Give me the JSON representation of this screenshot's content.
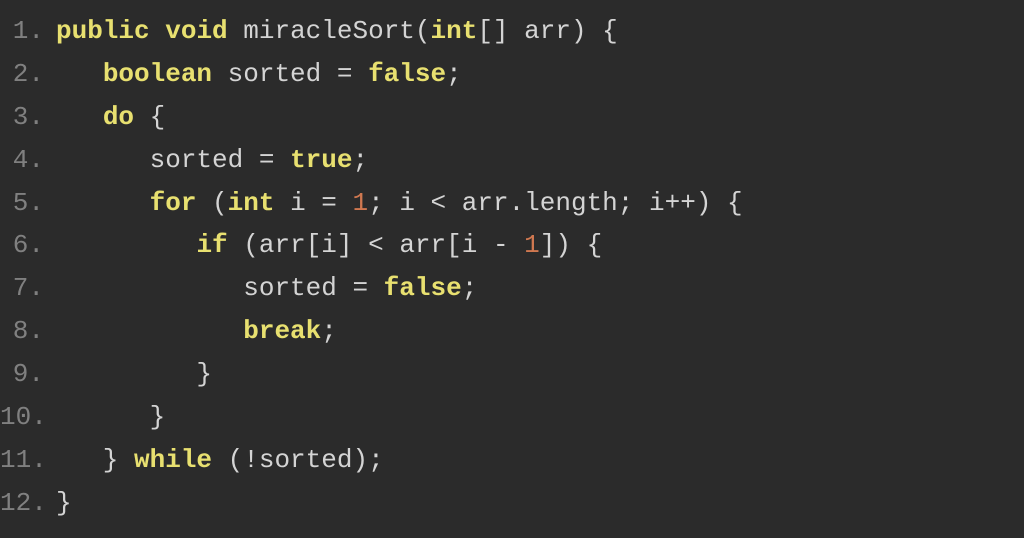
{
  "code": {
    "lines": [
      {
        "num": "1.",
        "tokens": [
          {
            "cls": "keyword",
            "t": "public"
          },
          {
            "cls": "punct",
            "t": " "
          },
          {
            "cls": "keyword",
            "t": "void"
          },
          {
            "cls": "punct",
            "t": " "
          },
          {
            "cls": "ident",
            "t": "miracleSort"
          },
          {
            "cls": "punct",
            "t": "("
          },
          {
            "cls": "type",
            "t": "int"
          },
          {
            "cls": "punct",
            "t": "[] "
          },
          {
            "cls": "ident",
            "t": "arr"
          },
          {
            "cls": "punct",
            "t": ") {"
          }
        ]
      },
      {
        "num": "2.",
        "tokens": [
          {
            "cls": "punct",
            "t": "   "
          },
          {
            "cls": "type",
            "t": "boolean"
          },
          {
            "cls": "punct",
            "t": " "
          },
          {
            "cls": "ident",
            "t": "sorted"
          },
          {
            "cls": "punct",
            "t": " = "
          },
          {
            "cls": "bool",
            "t": "false"
          },
          {
            "cls": "punct",
            "t": ";"
          }
        ]
      },
      {
        "num": "3.",
        "tokens": [
          {
            "cls": "punct",
            "t": "   "
          },
          {
            "cls": "keyword",
            "t": "do"
          },
          {
            "cls": "punct",
            "t": " {"
          }
        ]
      },
      {
        "num": "4.",
        "tokens": [
          {
            "cls": "punct",
            "t": "      "
          },
          {
            "cls": "ident",
            "t": "sorted"
          },
          {
            "cls": "punct",
            "t": " = "
          },
          {
            "cls": "bool",
            "t": "true"
          },
          {
            "cls": "punct",
            "t": ";"
          }
        ]
      },
      {
        "num": "5.",
        "tokens": [
          {
            "cls": "punct",
            "t": "      "
          },
          {
            "cls": "keyword",
            "t": "for"
          },
          {
            "cls": "punct",
            "t": " ("
          },
          {
            "cls": "type",
            "t": "int"
          },
          {
            "cls": "punct",
            "t": " "
          },
          {
            "cls": "ident",
            "t": "i"
          },
          {
            "cls": "punct",
            "t": " = "
          },
          {
            "cls": "num",
            "t": "1"
          },
          {
            "cls": "punct",
            "t": "; "
          },
          {
            "cls": "ident",
            "t": "i"
          },
          {
            "cls": "punct",
            "t": " < "
          },
          {
            "cls": "ident",
            "t": "arr"
          },
          {
            "cls": "punct",
            "t": "."
          },
          {
            "cls": "ident",
            "t": "length"
          },
          {
            "cls": "punct",
            "t": "; "
          },
          {
            "cls": "ident",
            "t": "i"
          },
          {
            "cls": "punct",
            "t": "++) {"
          }
        ]
      },
      {
        "num": "6.",
        "tokens": [
          {
            "cls": "punct",
            "t": "         "
          },
          {
            "cls": "keyword",
            "t": "if"
          },
          {
            "cls": "punct",
            "t": " ("
          },
          {
            "cls": "ident",
            "t": "arr"
          },
          {
            "cls": "punct",
            "t": "["
          },
          {
            "cls": "ident",
            "t": "i"
          },
          {
            "cls": "punct",
            "t": "] < "
          },
          {
            "cls": "ident",
            "t": "arr"
          },
          {
            "cls": "punct",
            "t": "["
          },
          {
            "cls": "ident",
            "t": "i"
          },
          {
            "cls": "punct",
            "t": " - "
          },
          {
            "cls": "num",
            "t": "1"
          },
          {
            "cls": "punct",
            "t": "]) {"
          }
        ]
      },
      {
        "num": "7.",
        "tokens": [
          {
            "cls": "punct",
            "t": "            "
          },
          {
            "cls": "ident",
            "t": "sorted"
          },
          {
            "cls": "punct",
            "t": " = "
          },
          {
            "cls": "bool",
            "t": "false"
          },
          {
            "cls": "punct",
            "t": ";"
          }
        ]
      },
      {
        "num": "8.",
        "tokens": [
          {
            "cls": "punct",
            "t": "            "
          },
          {
            "cls": "keyword",
            "t": "break"
          },
          {
            "cls": "punct",
            "t": ";"
          }
        ]
      },
      {
        "num": "9.",
        "tokens": [
          {
            "cls": "punct",
            "t": "         }"
          }
        ]
      },
      {
        "num": "10.",
        "tokens": [
          {
            "cls": "punct",
            "t": "      }"
          }
        ]
      },
      {
        "num": "11.",
        "tokens": [
          {
            "cls": "punct",
            "t": "   } "
          },
          {
            "cls": "keyword",
            "t": "while"
          },
          {
            "cls": "punct",
            "t": " (!"
          },
          {
            "cls": "ident",
            "t": "sorted"
          },
          {
            "cls": "punct",
            "t": ");"
          }
        ]
      },
      {
        "num": "12.",
        "tokens": [
          {
            "cls": "punct",
            "t": "}"
          }
        ]
      }
    ]
  }
}
